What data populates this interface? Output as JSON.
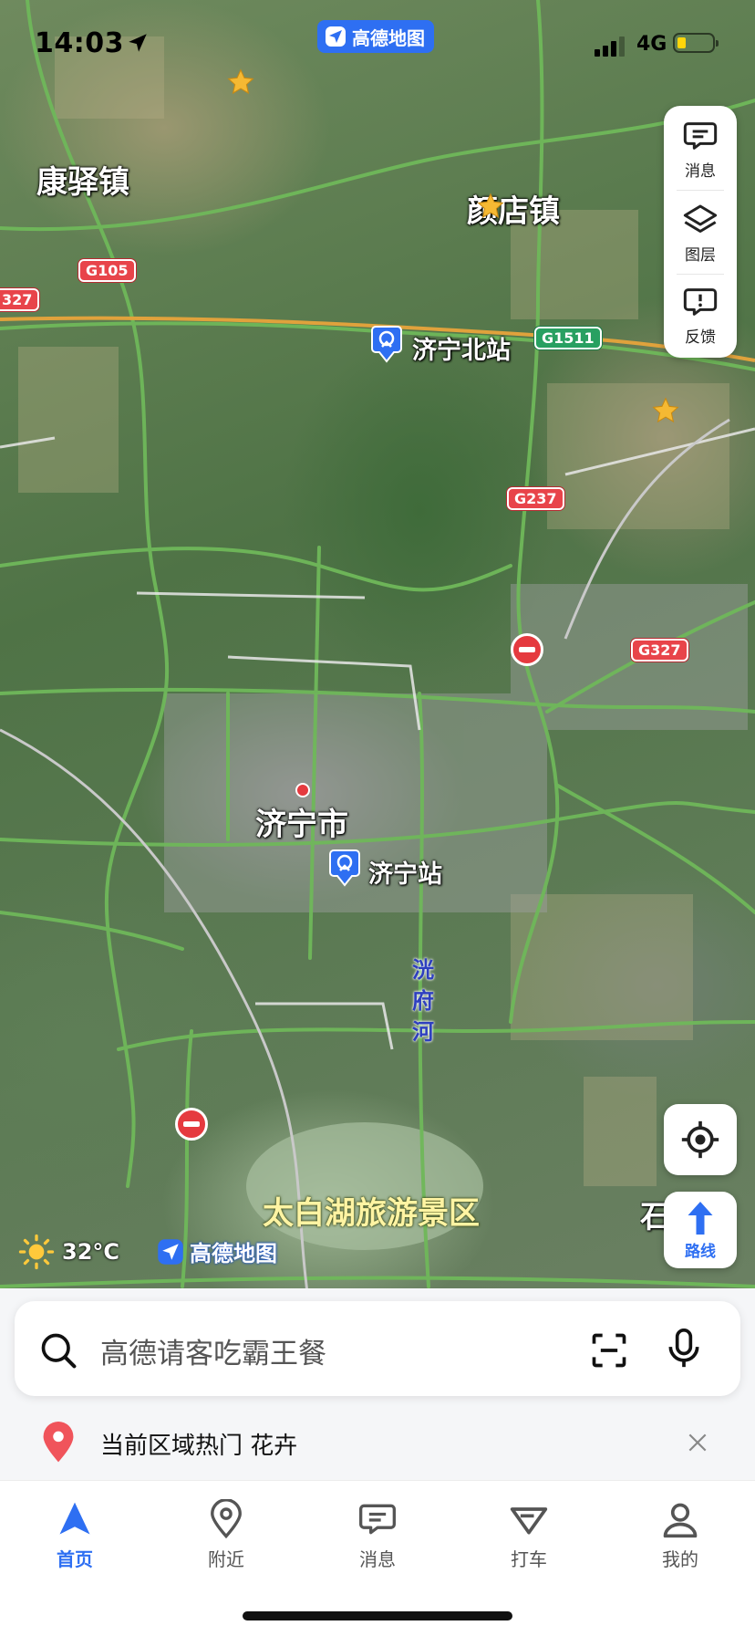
{
  "status_bar": {
    "time": "14:03",
    "network": "4G",
    "app_badge": "高德地图",
    "battery_color": "#ffd60a"
  },
  "map": {
    "places": {
      "kangyi": "康驿镇",
      "yandian": "颜店镇",
      "jining_north": "济宁北站",
      "jining_city": "济宁市",
      "jining_station": "济宁站",
      "river": "洸府河",
      "taibai_lake": "太白湖旅游景区",
      "shiqiao_partial": "石桥镇"
    },
    "road_shields": {
      "g105": "G105",
      "g327_left": "327",
      "g1511": "G1511",
      "g237": "G237",
      "g327_right": "G327"
    },
    "colors": {
      "road": "#6fb85a",
      "highway": "#e0a23c",
      "shield_red": "#e8444a",
      "shield_green": "#28a061",
      "accent": "#2e6ff2"
    }
  },
  "tools": {
    "messages": "消息",
    "layers": "图层",
    "feedback": "反馈",
    "route": "路线"
  },
  "weather": {
    "temperature": "32°C",
    "watermark": "高德地图"
  },
  "search": {
    "placeholder": "高德请客吃霸王餐"
  },
  "hot_bar": {
    "text": "当前区域热门 花卉"
  },
  "tabbar": {
    "home": "首页",
    "nearby": "附近",
    "messages": "消息",
    "taxi": "打车",
    "mine": "我的"
  }
}
